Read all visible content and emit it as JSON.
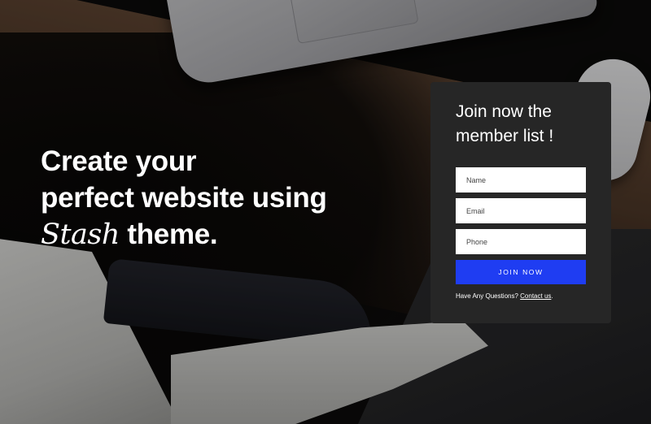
{
  "hero": {
    "line1": "Create your",
    "line2": "perfect website using",
    "brand": "Stash",
    "line3_suffix": " theme."
  },
  "signup": {
    "title_line1": "Join now the",
    "title_line2": "member list !",
    "name_placeholder": "Name",
    "email_placeholder": "Email",
    "phone_placeholder": "Phone",
    "submit_label": "JOIN NOW",
    "help_text": "Have Any Questions? ",
    "contact_link": "Contact us",
    "help_suffix": "."
  },
  "colors": {
    "card_background": "#262626",
    "button_accent": "#1f3df2",
    "text": "#ffffff"
  }
}
